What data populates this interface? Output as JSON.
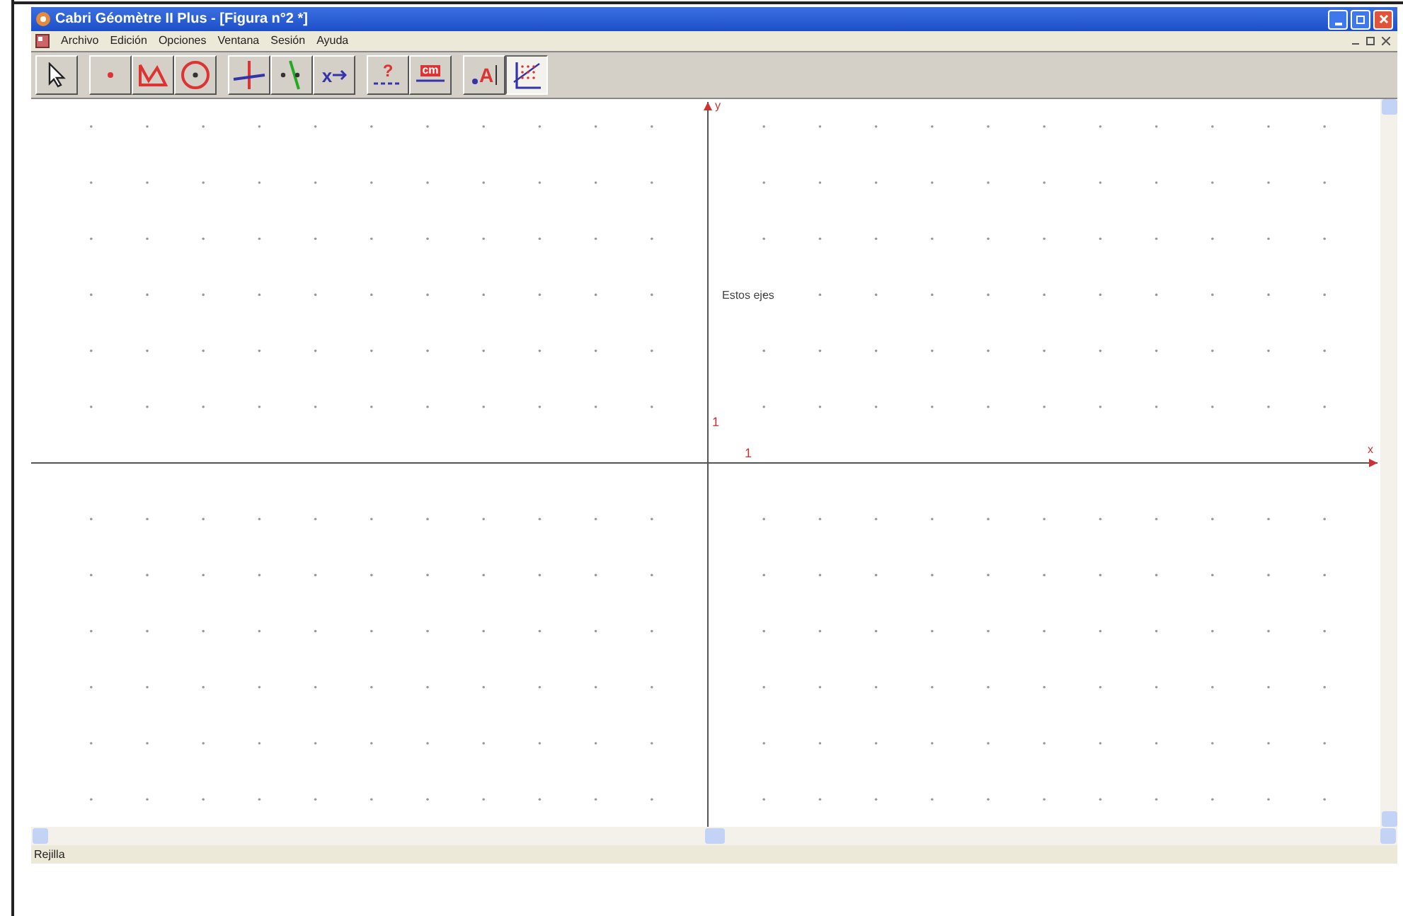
{
  "window": {
    "title": "Cabri Géomètre II Plus - [Figura n°2 *]"
  },
  "menu": [
    "Archivo",
    "Edición",
    "Opciones",
    "Ventana",
    "Sesión",
    "Ayuda"
  ],
  "toolbar": [
    {
      "tools": [
        {
          "kind": "pointer",
          "selected": false
        }
      ]
    },
    {
      "tools": [
        {
          "kind": "point",
          "selected": false
        },
        {
          "kind": "polygon",
          "selected": false
        },
        {
          "kind": "circle",
          "selected": false
        }
      ]
    },
    {
      "tools": [
        {
          "kind": "perpendicular",
          "selected": false
        },
        {
          "kind": "parallel",
          "selected": false
        },
        {
          "kind": "transform",
          "glyph": "x",
          "selected": false
        }
      ]
    },
    {
      "tools": [
        {
          "kind": "question",
          "glyph": "?",
          "selected": false
        },
        {
          "kind": "measure",
          "glyph": "cm",
          "selected": false
        }
      ]
    },
    {
      "tools": [
        {
          "kind": "text",
          "glyph": "A",
          "selected": false
        },
        {
          "kind": "grid",
          "selected": true
        }
      ]
    }
  ],
  "canvas": {
    "note": "Estos ejes",
    "y_axis_label": "y",
    "x_axis_label": "x",
    "y_unit": "1",
    "x_unit": "1"
  },
  "status_bar": "Rejilla"
}
